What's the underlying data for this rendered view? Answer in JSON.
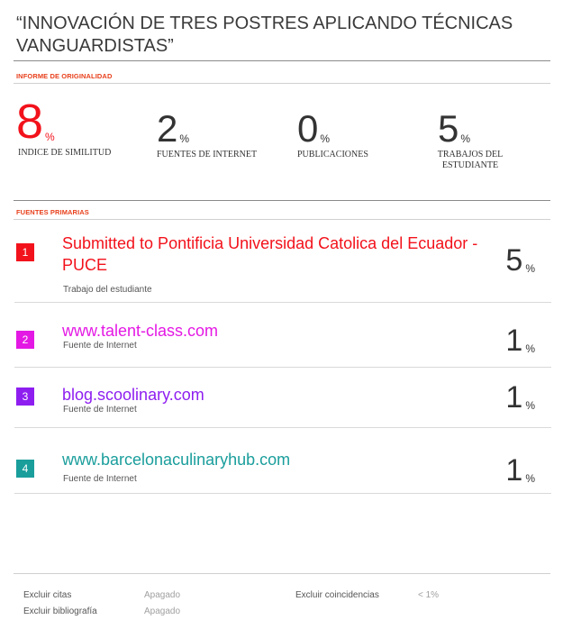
{
  "document": {
    "title": "“INNOVACIÓN DE TRES POSTRES APLICANDO TÉCNICAS VANGUARDISTAS”"
  },
  "report": {
    "section_label": "INFORME DE ORIGINALIDAD",
    "stats": [
      {
        "value": "8",
        "unit": "%",
        "label": "INDICE DE SIMILITUD"
      },
      {
        "value": "2",
        "unit": "%",
        "label": "FUENTES DE INTERNET"
      },
      {
        "value": "0",
        "unit": "%",
        "label": "PUBLICACIONES"
      },
      {
        "value": "5",
        "unit": "%",
        "label": "TRABAJOS DEL ESTUDIANTE"
      }
    ],
    "accent_color": "#f2121b"
  },
  "sources": {
    "section_label": "FUENTES PRIMARIAS",
    "items": [
      {
        "rank": "1",
        "name": "Submitted to Pontificia Universidad Catolica del Ecuador - PUCE",
        "type": "Trabajo del estudiante",
        "percent": "5",
        "unit": "%",
        "color": "#f2121b"
      },
      {
        "rank": "2",
        "name": "www.talent-class.com",
        "type": "Fuente de Internet",
        "percent": "1",
        "unit": "%",
        "color": "#e418e4"
      },
      {
        "rank": "3",
        "name": "blog.scoolinary.com",
        "type": "Fuente de Internet",
        "percent": "1",
        "unit": "%",
        "color": "#8e1ef0"
      },
      {
        "rank": "4",
        "name": "www.barcelonaculinaryhub.com",
        "type": "Fuente de Internet",
        "percent": "1",
        "unit": "%",
        "color": "#1a9e9c"
      }
    ]
  },
  "footer": {
    "exclude_quotes_label": "Excluir citas",
    "exclude_quotes_value": "Apagado",
    "exclude_bibliography_label": "Excluir bibliografía",
    "exclude_bibliography_value": "Apagado",
    "exclude_matches_label": "Excluir coincidencias",
    "exclude_matches_value": "< 1%"
  }
}
